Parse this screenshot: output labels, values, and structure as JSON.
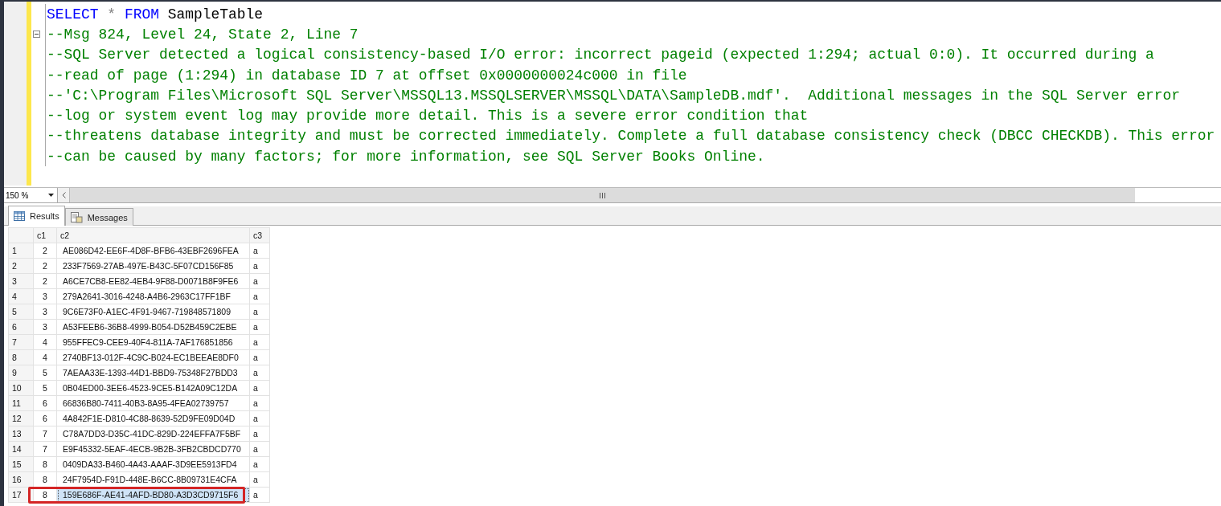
{
  "editor": {
    "lines": [
      {
        "kind": "query",
        "collapsible": false,
        "parts": [
          {
            "kind": "keyword",
            "text": "SELECT"
          },
          {
            "kind": "operator",
            "text": " * "
          },
          {
            "kind": "keyword",
            "text": "FROM"
          },
          {
            "kind": "plain",
            "text": " SampleTable"
          }
        ]
      },
      {
        "kind": "comment",
        "collapsible": true,
        "text": "--Msg 824, Level 24, State 2, Line 7"
      },
      {
        "kind": "comment",
        "collapsible": false,
        "text": "--SQL Server detected a logical consistency-based I/O error: incorrect pageid (expected 1:294; actual 0:0). It occurred during a"
      },
      {
        "kind": "comment",
        "collapsible": false,
        "text": "--read of page (1:294) in database ID 7 at offset 0x0000000024c000 in file"
      },
      {
        "kind": "comment",
        "collapsible": false,
        "text": "--'C:\\Program Files\\Microsoft SQL Server\\MSSQL13.MSSQLSERVER\\MSSQL\\DATA\\SampleDB.mdf'.  Additional messages in the SQL Server error"
      },
      {
        "kind": "comment",
        "collapsible": false,
        "text": "--log or system event log may provide more detail. This is a severe error condition that"
      },
      {
        "kind": "comment",
        "collapsible": false,
        "text": "--threatens database integrity and must be corrected immediately. Complete a full database consistency check (DBCC CHECKDB). This error"
      },
      {
        "kind": "comment",
        "collapsible": false,
        "text": "--can be caused by many factors; for more information, see SQL Server Books Online."
      }
    ]
  },
  "zoom": {
    "value": "150 %"
  },
  "tabs": [
    {
      "label": "Results",
      "selected": true
    },
    {
      "label": "Messages",
      "selected": false
    }
  ],
  "grid": {
    "columns": [
      "c1",
      "c2",
      "c3"
    ],
    "rows": [
      {
        "num": "1",
        "cells": [
          "2",
          "AE086D42-EE6F-4D8F-BFB6-43EBF2696FEA",
          "a"
        ],
        "selected": false,
        "outlined": false
      },
      {
        "num": "2",
        "cells": [
          "2",
          "233F7569-27AB-497E-B43C-5F07CD156F85",
          "a"
        ],
        "selected": false,
        "outlined": false
      },
      {
        "num": "3",
        "cells": [
          "2",
          "A6CE7CB8-EE82-4EB4-9F88-D0071B8F9FE6",
          "a"
        ],
        "selected": false,
        "outlined": false
      },
      {
        "num": "4",
        "cells": [
          "3",
          "279A2641-3016-4248-A4B6-2963C17FF1BF",
          "a"
        ],
        "selected": false,
        "outlined": false
      },
      {
        "num": "5",
        "cells": [
          "3",
          "9C6E73F0-A1EC-4F91-9467-719848571809",
          "a"
        ],
        "selected": false,
        "outlined": false
      },
      {
        "num": "6",
        "cells": [
          "3",
          "A53FEEB6-36B8-4999-B054-D52B459C2EBE",
          "a"
        ],
        "selected": false,
        "outlined": false
      },
      {
        "num": "7",
        "cells": [
          "4",
          "955FFEC9-CEE9-40F4-811A-7AF176851856",
          "a"
        ],
        "selected": false,
        "outlined": false
      },
      {
        "num": "8",
        "cells": [
          "4",
          "2740BF13-012F-4C9C-B024-EC1BEEAE8DF0",
          "a"
        ],
        "selected": false,
        "outlined": false
      },
      {
        "num": "9",
        "cells": [
          "5",
          "7AEAA33E-1393-44D1-BBD9-75348F27BDD3",
          "a"
        ],
        "selected": false,
        "outlined": false
      },
      {
        "num": "10",
        "cells": [
          "5",
          "0B04ED00-3EE6-4523-9CE5-B142A09C12DA",
          "a"
        ],
        "selected": false,
        "outlined": false
      },
      {
        "num": "11",
        "cells": [
          "6",
          "66836B80-7411-40B3-8A95-4FEA02739757",
          "a"
        ],
        "selected": false,
        "outlined": false
      },
      {
        "num": "12",
        "cells": [
          "6",
          "4A842F1E-D810-4C88-8639-52D9FE09D04D",
          "a"
        ],
        "selected": false,
        "outlined": false
      },
      {
        "num": "13",
        "cells": [
          "7",
          "C78A7DD3-D35C-41DC-829D-224EFFA7F5BF",
          "a"
        ],
        "selected": false,
        "outlined": false
      },
      {
        "num": "14",
        "cells": [
          "7",
          "E9F45332-5EAF-4ECB-9B2B-3FB2CBDCD770",
          "a"
        ],
        "selected": false,
        "outlined": false
      },
      {
        "num": "15",
        "cells": [
          "8",
          "0409DA33-B460-4A43-AAAF-3D9EE5913FD4",
          "a"
        ],
        "selected": false,
        "outlined": false
      },
      {
        "num": "16",
        "cells": [
          "8",
          "24F7954D-F91D-448E-B6CC-8B09731E4CFA",
          "a"
        ],
        "selected": false,
        "outlined": false
      },
      {
        "num": "17",
        "cells": [
          "8",
          "159E686F-AE41-4AFD-BD80-A3D3CD9715F6",
          "a"
        ],
        "selected": true,
        "outlined": true
      }
    ]
  }
}
